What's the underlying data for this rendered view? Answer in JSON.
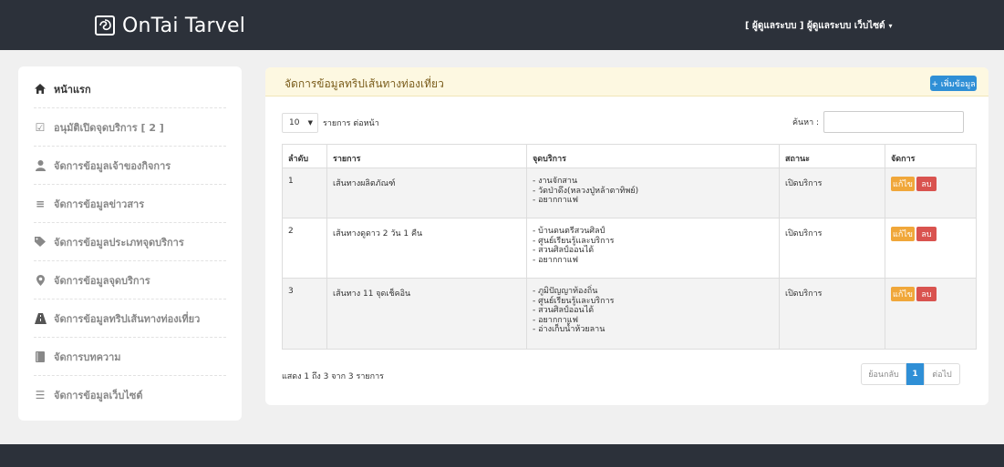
{
  "navbar": {
    "brand": "OnTai Tarvel",
    "user_menu": "[ ผู้ดูแลระบบ ] ผู้ดูแลระบบ เว็บไซต์",
    "caret": "▾"
  },
  "sidebar": {
    "items": [
      {
        "label": "หน้าแรก",
        "icon": "home-icon",
        "glyph": "⌂"
      },
      {
        "label": "อนุมัติเปิดจุดบริการ [ 2 ]",
        "icon": "check-square-icon",
        "glyph": "☑"
      },
      {
        "label": "จัดการข้อมูลเจ้าของกิจการ",
        "icon": "user-icon",
        "glyph": "●"
      },
      {
        "label": "จัดการข้อมูลข่าวสาร",
        "icon": "list-icon",
        "glyph": "≡"
      },
      {
        "label": "จัดการข้อมูลประเภทจุดบริการ",
        "icon": "tags-icon",
        "glyph": "◆"
      },
      {
        "label": "จัดการข้อมูลจุดบริการ",
        "icon": "map-marker-icon",
        "glyph": "◉"
      },
      {
        "label": "จัดการข้อมูลทริปเส้นทางท่องเที่ยว",
        "icon": "road-icon",
        "glyph": "▲"
      },
      {
        "label": "จัดการบทความ",
        "icon": "book-icon",
        "glyph": "■"
      },
      {
        "label": "จัดการข้อมูลเว็บไซต์",
        "icon": "th-list-icon",
        "glyph": "☰"
      }
    ]
  },
  "panel": {
    "title": "จัดการข้อมูลทริปเส้นทางท่องเที่ยว",
    "add_button": "+ เพิ่มข้อมูล",
    "length_value": "10",
    "length_arrow": "▼",
    "length_label": "รายการ ต่อหน้า",
    "search_label": "ค้นหา :",
    "search_value": ""
  },
  "table": {
    "headers": [
      "ลำดับ",
      "รายการ",
      "จุดบริการ",
      "สถานะ",
      "จัดการ"
    ],
    "rows": [
      {
        "no": "1",
        "name": "เส้นทางผลิตภัณฑ์",
        "services": [
          "- งานจักสาน",
          "- วัดป่าดึง(หลวงปู่หล้าตาทิพย์)",
          "- อยากกาแฟ"
        ],
        "status": "เปิดบริการ"
      },
      {
        "no": "2",
        "name": "เส้นทางดูดาว 2 วัน 1 คืน",
        "services": [
          "- บ้านดนตรีสวนศิลป์",
          "- ศูนย์เรียนรู้และบริการ",
          "- สวนศิลป์ออนได้",
          "- อยากกาแฟ"
        ],
        "status": "เปิดบริการ"
      },
      {
        "no": "3",
        "name": "เส้นทาง 11 จุดเช็คอิน",
        "services": [
          "- ภูมิปัญญาท้องถิ่น",
          "- ศูนย์เรียนรู้และบริการ",
          "- สวนศิลป์ออนได้",
          "- อยากกาแฟ",
          "- อ่างเก็บน้ำห้วยลาน"
        ],
        "status": "เปิดบริการ"
      }
    ],
    "edit_label": "แก้ไข",
    "delete_label": "ลบ"
  },
  "footer_info": "แสดง 1 ถึง 3 จาก 3 รายการ",
  "pagination": {
    "prev": "ย้อนกลับ",
    "current": "1",
    "next": "ต่อไป"
  }
}
